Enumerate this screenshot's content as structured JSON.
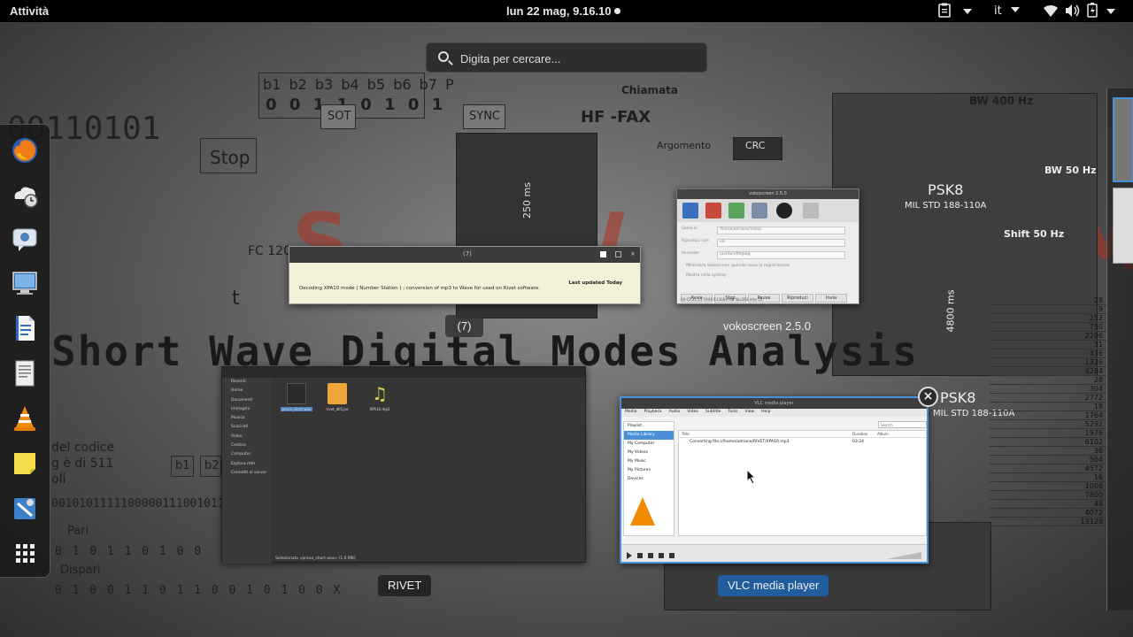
{
  "topbar": {
    "activities": "Attività",
    "clock": "lun 22 mag,  9.16.10",
    "language": "it"
  },
  "search": {
    "placeholder": "Digita per cercare..."
  },
  "dash": {
    "items": [
      {
        "name": "firefox-icon"
      },
      {
        "name": "backup-icon"
      },
      {
        "name": "chat-icon"
      },
      {
        "name": "screen-icon"
      },
      {
        "name": "writer-document-icon"
      },
      {
        "name": "text-editor-icon"
      },
      {
        "name": "vlc-icon"
      },
      {
        "name": "notes-icon"
      },
      {
        "name": "software-icon"
      },
      {
        "name": "show-applications-icon"
      }
    ]
  },
  "background": {
    "bits": "00110101",
    "bit_header": [
      "b1",
      "b2",
      "b3",
      "b4",
      "b5",
      "b6",
      "b7",
      "P"
    ],
    "bit_row": [
      "0",
      "0",
      "1",
      "1",
      "0",
      "1",
      "0",
      "1"
    ],
    "sot": "SOT",
    "sync": "SYNC",
    "stop": "Stop",
    "chiamata": "Chiamata",
    "hf_fax": "HF -FAX",
    "argomento": "Argomento",
    "crc": "CRC",
    "bw400": "BW 400 Hz",
    "bw50": "BW 50 Hz",
    "shift50": "Shift 50 Hz",
    "psk8": "PSK8",
    "mil_std": "MIL STD 188-110A",
    "psk8_b": "PSK8",
    "mil_std_b": "MIL STD 188-110A",
    "fc": "FC 120",
    "ms250": "250 ms",
    "ms4800": "4800 ms",
    "banner": "Short Wave Digital Modes Analysis",
    "big_letters": "S.W.D.M.A.",
    "pari": "Pari",
    "dispari": "Dispari",
    "codice": "del codice\ng è di 511\noli",
    "bits_row1": "00101011111000001110010110",
    "bits_row2": "0 1 0 1 1 0 1 0 0",
    "bits_row3": "0 1 0 0 1 1 0 1 1 0 0 1 0 1 0 0 X",
    "t": "t",
    "b1": "b1",
    "b2": "b2",
    "x1": "X",
    "table_vals": [
      "28",
      "9",
      "252",
      "750",
      "2296",
      "31",
      "476",
      "1326",
      "4284",
      "28",
      "304",
      "2772",
      "18",
      "1764",
      "5292",
      "1976",
      "6102",
      "36",
      "504",
      "4572",
      "16",
      "1008",
      "7800",
      "48",
      "4072",
      "13129"
    ]
  },
  "windows": {
    "notification": {
      "title": "(7)",
      "message": "Decoding XPA10 mode ( Number Station ) ; conversion of mp3 to Wave for used on Rivet software.",
      "updated": "Last updated Today",
      "count_badge": "(7)"
    },
    "vokoscreen": {
      "window_title": "vokoscreen 2.5.0",
      "label": "vokoscreen 2.5.0",
      "rows": [
        {
          "k": "Salva in",
          "v": "/home/adriano/Video"
        },
        {
          "k": "Riproduci con",
          "v": "vlc"
        },
        {
          "k": "Recorder",
          "v": "/usr/bin/ffmpeg"
        }
      ],
      "checks": [
        "Minimizza Vokoscreen quando inizia la registrazione",
        "Mostra nella systray"
      ],
      "buttons": [
        "Avvia",
        "Stop",
        "Pausa",
        "Riproduci",
        "Invia"
      ],
      "status": "00:01:25      25      1944      P.1366x768      libx264 mkv      25"
    },
    "rivet": {
      "label": "RIVET",
      "sidebar": [
        "Recenti",
        "Home",
        "Documenti",
        "Immagini",
        "Musica",
        "Scaricati",
        "Video",
        "Cestino",
        "Computer",
        "Esplora rete",
        "Connetti al server"
      ],
      "files": [
        "prova_short.wav",
        "rivet_dll5.jar",
        "XPA10.mp3"
      ],
      "footer": "Selezionato «prova_short.wav» (1,6 MB)"
    },
    "vlc": {
      "window_title": "VLC media player",
      "label": "VLC media player",
      "menu": [
        "Media",
        "Playback",
        "Audio",
        "Video",
        "Subtitle",
        "Tools",
        "View",
        "Help"
      ],
      "playlist_side": [
        "Playlist",
        "Media Library",
        "My Computer",
        "My Videos",
        "My Music",
        "My Pictures",
        "Devices"
      ],
      "columns": [
        "Title",
        "Duration",
        "Album"
      ],
      "row": {
        "title": "Converting file:///home/adriano/RIVET/XPA10.mp3",
        "duration": "03:24"
      },
      "search_placeholder": "Search"
    }
  },
  "colors": {
    "active_label": "#215d9c",
    "topbar": "#000000",
    "banner_red": "#b3321f"
  }
}
